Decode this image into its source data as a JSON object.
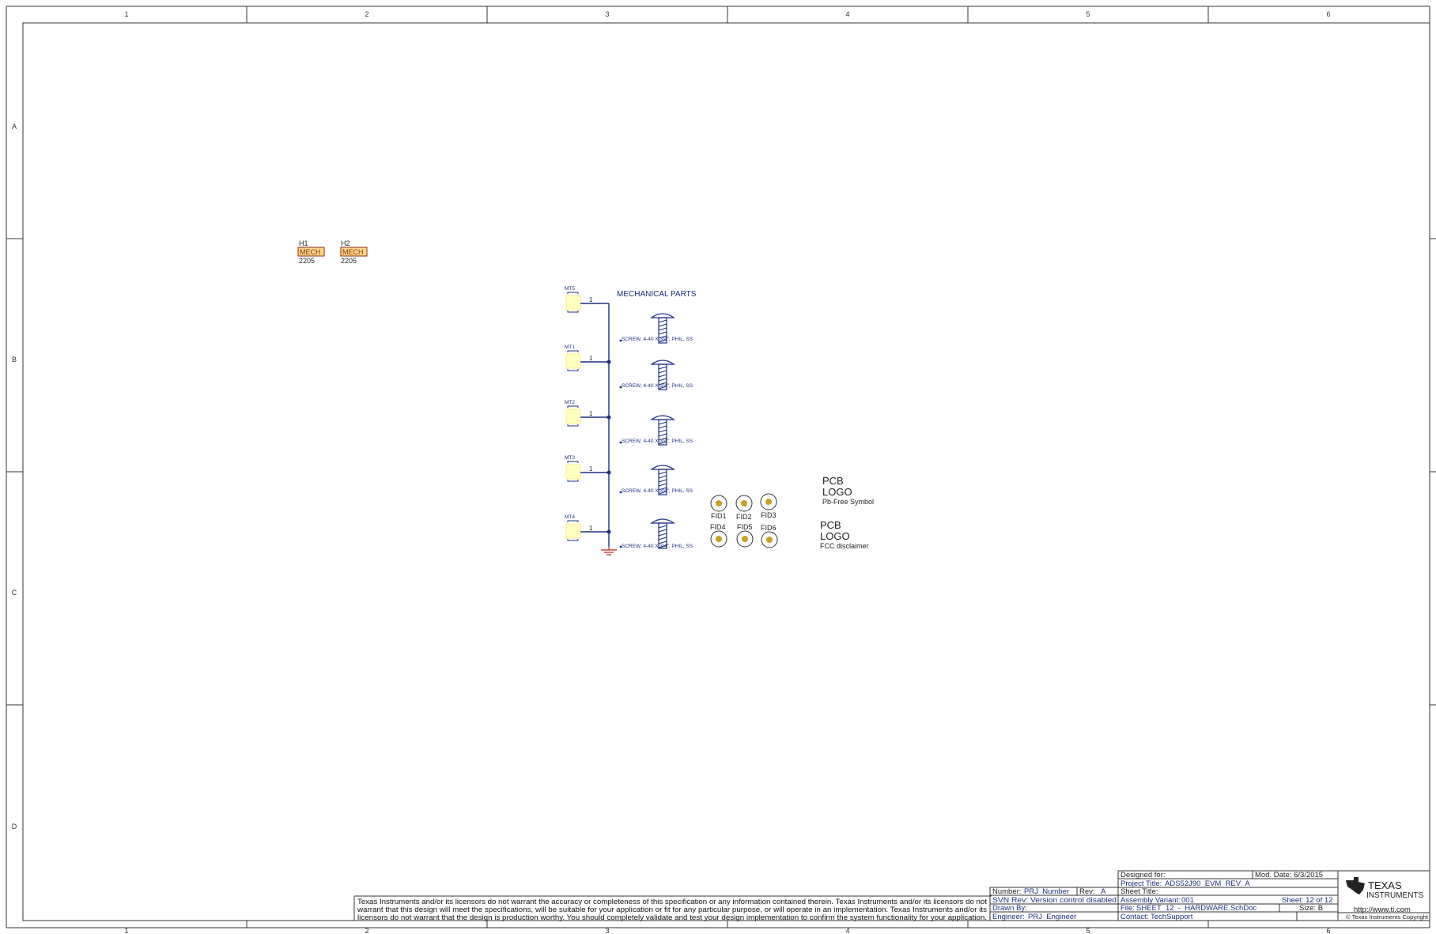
{
  "frame": {
    "columns": [
      "1",
      "2",
      "3",
      "4",
      "5",
      "6"
    ],
    "rows": [
      "A",
      "B",
      "C",
      "D"
    ]
  },
  "holes": [
    {
      "ref": "H1",
      "part": "MECH",
      "value": "2205"
    },
    {
      "ref": "H2",
      "part": "MECH",
      "value": "2205"
    }
  ],
  "mechanical": {
    "title": "MECHANICAL PARTS",
    "pin_label": "1",
    "mount_refs": [
      "MT5",
      "MT1",
      "MT2",
      "MT3",
      "MT4"
    ],
    "screw_label": "SCREW, 4-40 X 3/4\", PHIL, SS"
  },
  "fiducials": [
    "FID1",
    "FID2",
    "FID3",
    "FID4",
    "FID5",
    "FID6"
  ],
  "logos": [
    {
      "line1": "PCB",
      "line2": "LOGO",
      "caption": "Pb-Free  Symbol"
    },
    {
      "line1": "PCB",
      "line2": "LOGO",
      "caption": "FCC  disclaimer"
    }
  ],
  "disclaimer": [
    "Texas Instruments and/or its licensors do not warrant the accuracy or completeness of this specification or any information contained therein. Texas Instruments and/or its licensors do not",
    "warrant that this design will meet the specifications, will be suitable for your application or fit for any particular purpose, or will operate in an implementation. Texas Instruments and/or its",
    "licensors do not warrant that the design is production worthy. You should completely validate and test your design implementation to confirm the system functionality for your application."
  ],
  "title_block": {
    "number_label": "Number:",
    "number": "PRJ_Number",
    "rev_label": "Rev:",
    "rev": "A",
    "svn": "SVN Rev: Version control disabled",
    "drawn_by": "Drawn By:",
    "engineer_label": "Engineer:",
    "engineer": "PRJ_Engineer",
    "designed_for": "Designed  for:",
    "mod_date": "Mod.  Date: 6/3/2015",
    "project_title_label": "Project  Title:",
    "project_title": "ADS52J90_EVM_REV_A",
    "sheet_title": "Sheet  Title:",
    "assembly_label": "Assembly  Variant:",
    "assembly": "001",
    "sheet": "Sheet: 12 of  12",
    "file_label": "File:",
    "file": "SHEET_12_-_HARDWARE.SchDoc",
    "size": "Size: B",
    "contact_label": "Contact:",
    "contact": "TechSupport",
    "logo_text_1": "TEXAS",
    "logo_text_2": "INSTRUMENTS",
    "url": "http://www.ti.com",
    "copyright": "© Texas Instruments Copyright"
  },
  "colors": {
    "wire": "#1c2f80",
    "component_fill": "#ffffc0",
    "component_stroke": "#8b2a10",
    "mech_fill": "#ffd98a",
    "fiducial": "#c8a020",
    "ground": "#c02020",
    "border": "#333333"
  }
}
